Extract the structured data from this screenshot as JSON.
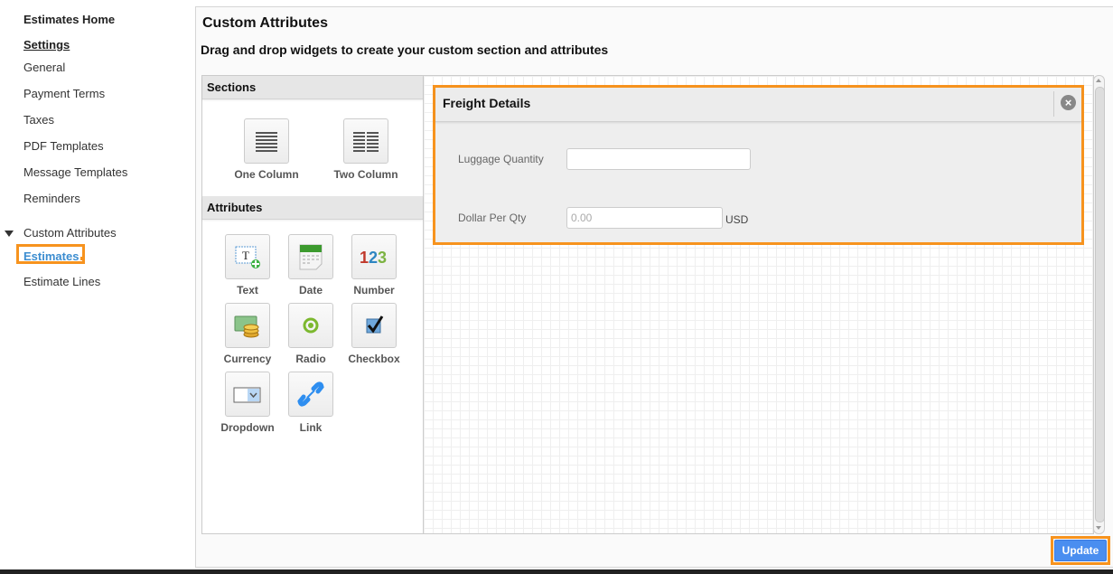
{
  "sidebar": {
    "home": "Estimates Home",
    "settings": "Settings",
    "items": [
      {
        "label": "General"
      },
      {
        "label": "Payment Terms"
      },
      {
        "label": "Taxes"
      },
      {
        "label": "PDF Templates"
      },
      {
        "label": "Message Templates"
      },
      {
        "label": "Reminders"
      }
    ],
    "group": "Custom Attributes",
    "active": "Estimates",
    "sub_items": [
      {
        "label": "Estimate Lines"
      }
    ]
  },
  "main": {
    "title": "Custom Attributes",
    "subtitle": "Drag and drop widgets to create your custom section and attributes",
    "sections_header": "Sections",
    "sections": [
      {
        "label": "One Column",
        "icon": "one-column-icon"
      },
      {
        "label": "Two Column",
        "icon": "two-column-icon"
      }
    ],
    "attributes_header": "Attributes",
    "attributes": [
      {
        "label": "Text",
        "icon": "text-icon"
      },
      {
        "label": "Date",
        "icon": "calendar-icon"
      },
      {
        "label": "Number",
        "icon": "number-icon"
      },
      {
        "label": "Currency",
        "icon": "currency-icon"
      },
      {
        "label": "Radio",
        "icon": "radio-icon"
      },
      {
        "label": "Checkbox",
        "icon": "checkbox-icon"
      },
      {
        "label": "Dropdown",
        "icon": "dropdown-icon"
      },
      {
        "label": "Link",
        "icon": "link-icon"
      }
    ]
  },
  "section": {
    "title": "Freight Details",
    "close": "×",
    "fields": [
      {
        "label": "Luggage Quantity",
        "value": "",
        "placeholder": ""
      },
      {
        "label": "Dollar Per Qty",
        "value": "",
        "placeholder": "0.00",
        "suffix": "USD"
      }
    ]
  },
  "footer": {
    "update_label": "Update"
  },
  "colors": {
    "highlight": "#f7931e",
    "primary_button": "#4a8ef0",
    "active_link": "#3c8dd0"
  }
}
